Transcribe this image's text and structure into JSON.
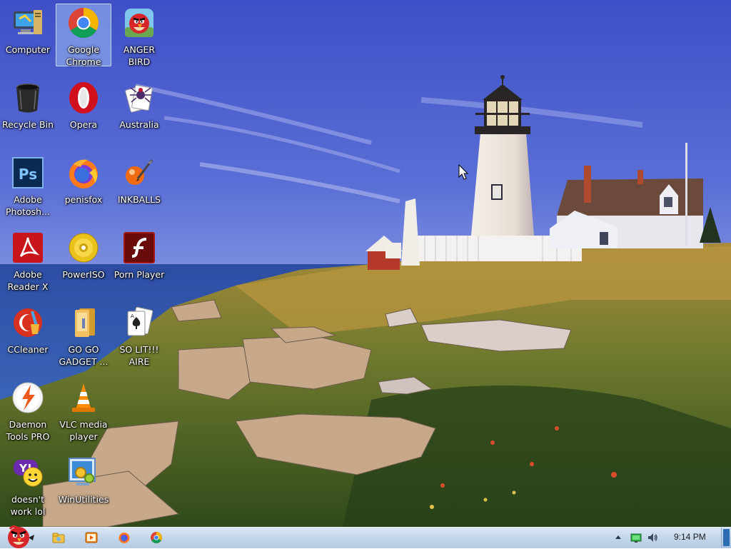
{
  "desktop": {
    "icons": [
      {
        "label": "Computer",
        "icon": "computer-icon"
      },
      {
        "label": "Google Chrome",
        "icon": "chrome-icon",
        "selected": true
      },
      {
        "label": "ANGER BIRD",
        "icon": "angry-bird-icon"
      },
      {
        "label": "Recycle Bin",
        "icon": "recycle-bin-icon"
      },
      {
        "label": "Opera",
        "icon": "opera-icon"
      },
      {
        "label": "Australia",
        "icon": "spider-solitaire-icon"
      },
      {
        "label": "Adobe Photosh...",
        "icon": "photoshop-icon"
      },
      {
        "label": "penisfox",
        "icon": "firefox-icon"
      },
      {
        "label": "INKBALLS",
        "icon": "inkball-icon"
      },
      {
        "label": "Adobe Reader X",
        "icon": "adobe-reader-icon"
      },
      {
        "label": "PowerISO",
        "icon": "poweriso-icon"
      },
      {
        "label": "Porn Player",
        "icon": "flash-player-icon"
      },
      {
        "label": "CCleaner",
        "icon": "ccleaner-icon"
      },
      {
        "label": "GO GO GADGET ...",
        "icon": "folder-icon"
      },
      {
        "label": "SO LIT!!! AIRE",
        "icon": "solitaire-icon"
      },
      {
        "label": "Daemon Tools PRO",
        "icon": "daemon-tools-icon"
      },
      {
        "label": "VLC media player",
        "icon": "vlc-icon"
      },
      {
        "label": "doesn't work lol",
        "icon": "yahoo-messenger-icon"
      },
      {
        "label": "WinUtilities",
        "icon": "winutilities-icon"
      }
    ]
  },
  "taskbar": {
    "start_icon": "angry-bird-start-icon",
    "pinned": [
      {
        "icon": "windows-explorer-icon"
      },
      {
        "icon": "media-player-icon"
      },
      {
        "icon": "firefox-icon"
      },
      {
        "icon": "chrome-icon"
      }
    ],
    "tray": {
      "icons": [
        "show-hidden-icons-arrow",
        "network-icon",
        "volume-icon"
      ],
      "clock": "9:14 PM"
    }
  },
  "colors": {
    "taskbar": "#c3d6ea",
    "selection": "#b4d7ff",
    "sky": "#4a5fc8",
    "sea": "#2a4fa0"
  }
}
